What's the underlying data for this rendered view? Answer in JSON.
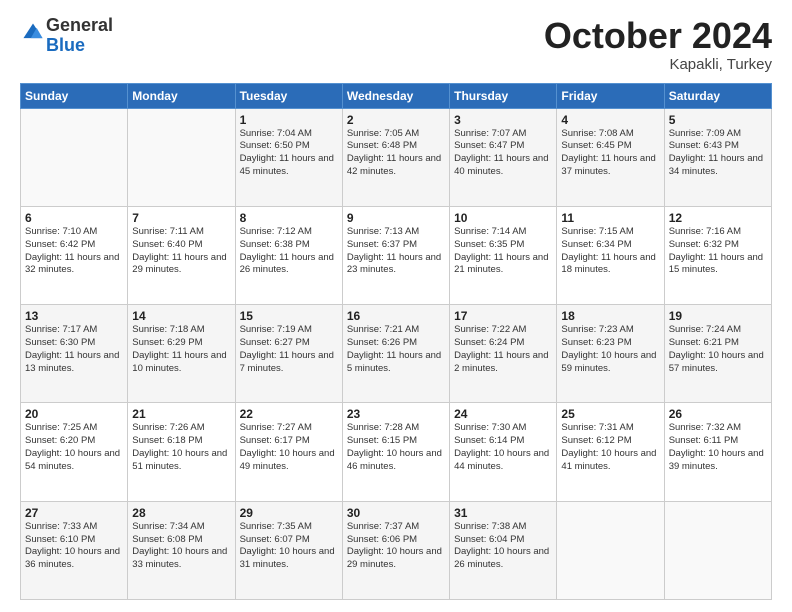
{
  "header": {
    "logo_general": "General",
    "logo_blue": "Blue",
    "month": "October 2024",
    "location": "Kapakli, Turkey"
  },
  "days_of_week": [
    "Sunday",
    "Monday",
    "Tuesday",
    "Wednesday",
    "Thursday",
    "Friday",
    "Saturday"
  ],
  "weeks": [
    [
      {
        "num": "",
        "info": ""
      },
      {
        "num": "",
        "info": ""
      },
      {
        "num": "1",
        "info": "Sunrise: 7:04 AM\nSunset: 6:50 PM\nDaylight: 11 hours and 45 minutes."
      },
      {
        "num": "2",
        "info": "Sunrise: 7:05 AM\nSunset: 6:48 PM\nDaylight: 11 hours and 42 minutes."
      },
      {
        "num": "3",
        "info": "Sunrise: 7:07 AM\nSunset: 6:47 PM\nDaylight: 11 hours and 40 minutes."
      },
      {
        "num": "4",
        "info": "Sunrise: 7:08 AM\nSunset: 6:45 PM\nDaylight: 11 hours and 37 minutes."
      },
      {
        "num": "5",
        "info": "Sunrise: 7:09 AM\nSunset: 6:43 PM\nDaylight: 11 hours and 34 minutes."
      }
    ],
    [
      {
        "num": "6",
        "info": "Sunrise: 7:10 AM\nSunset: 6:42 PM\nDaylight: 11 hours and 32 minutes."
      },
      {
        "num": "7",
        "info": "Sunrise: 7:11 AM\nSunset: 6:40 PM\nDaylight: 11 hours and 29 minutes."
      },
      {
        "num": "8",
        "info": "Sunrise: 7:12 AM\nSunset: 6:38 PM\nDaylight: 11 hours and 26 minutes."
      },
      {
        "num": "9",
        "info": "Sunrise: 7:13 AM\nSunset: 6:37 PM\nDaylight: 11 hours and 23 minutes."
      },
      {
        "num": "10",
        "info": "Sunrise: 7:14 AM\nSunset: 6:35 PM\nDaylight: 11 hours and 21 minutes."
      },
      {
        "num": "11",
        "info": "Sunrise: 7:15 AM\nSunset: 6:34 PM\nDaylight: 11 hours and 18 minutes."
      },
      {
        "num": "12",
        "info": "Sunrise: 7:16 AM\nSunset: 6:32 PM\nDaylight: 11 hours and 15 minutes."
      }
    ],
    [
      {
        "num": "13",
        "info": "Sunrise: 7:17 AM\nSunset: 6:30 PM\nDaylight: 11 hours and 13 minutes."
      },
      {
        "num": "14",
        "info": "Sunrise: 7:18 AM\nSunset: 6:29 PM\nDaylight: 11 hours and 10 minutes."
      },
      {
        "num": "15",
        "info": "Sunrise: 7:19 AM\nSunset: 6:27 PM\nDaylight: 11 hours and 7 minutes."
      },
      {
        "num": "16",
        "info": "Sunrise: 7:21 AM\nSunset: 6:26 PM\nDaylight: 11 hours and 5 minutes."
      },
      {
        "num": "17",
        "info": "Sunrise: 7:22 AM\nSunset: 6:24 PM\nDaylight: 11 hours and 2 minutes."
      },
      {
        "num": "18",
        "info": "Sunrise: 7:23 AM\nSunset: 6:23 PM\nDaylight: 10 hours and 59 minutes."
      },
      {
        "num": "19",
        "info": "Sunrise: 7:24 AM\nSunset: 6:21 PM\nDaylight: 10 hours and 57 minutes."
      }
    ],
    [
      {
        "num": "20",
        "info": "Sunrise: 7:25 AM\nSunset: 6:20 PM\nDaylight: 10 hours and 54 minutes."
      },
      {
        "num": "21",
        "info": "Sunrise: 7:26 AM\nSunset: 6:18 PM\nDaylight: 10 hours and 51 minutes."
      },
      {
        "num": "22",
        "info": "Sunrise: 7:27 AM\nSunset: 6:17 PM\nDaylight: 10 hours and 49 minutes."
      },
      {
        "num": "23",
        "info": "Sunrise: 7:28 AM\nSunset: 6:15 PM\nDaylight: 10 hours and 46 minutes."
      },
      {
        "num": "24",
        "info": "Sunrise: 7:30 AM\nSunset: 6:14 PM\nDaylight: 10 hours and 44 minutes."
      },
      {
        "num": "25",
        "info": "Sunrise: 7:31 AM\nSunset: 6:12 PM\nDaylight: 10 hours and 41 minutes."
      },
      {
        "num": "26",
        "info": "Sunrise: 7:32 AM\nSunset: 6:11 PM\nDaylight: 10 hours and 39 minutes."
      }
    ],
    [
      {
        "num": "27",
        "info": "Sunrise: 7:33 AM\nSunset: 6:10 PM\nDaylight: 10 hours and 36 minutes."
      },
      {
        "num": "28",
        "info": "Sunrise: 7:34 AM\nSunset: 6:08 PM\nDaylight: 10 hours and 33 minutes."
      },
      {
        "num": "29",
        "info": "Sunrise: 7:35 AM\nSunset: 6:07 PM\nDaylight: 10 hours and 31 minutes."
      },
      {
        "num": "30",
        "info": "Sunrise: 7:37 AM\nSunset: 6:06 PM\nDaylight: 10 hours and 29 minutes."
      },
      {
        "num": "31",
        "info": "Sunrise: 7:38 AM\nSunset: 6:04 PM\nDaylight: 10 hours and 26 minutes."
      },
      {
        "num": "",
        "info": ""
      },
      {
        "num": "",
        "info": ""
      }
    ]
  ]
}
